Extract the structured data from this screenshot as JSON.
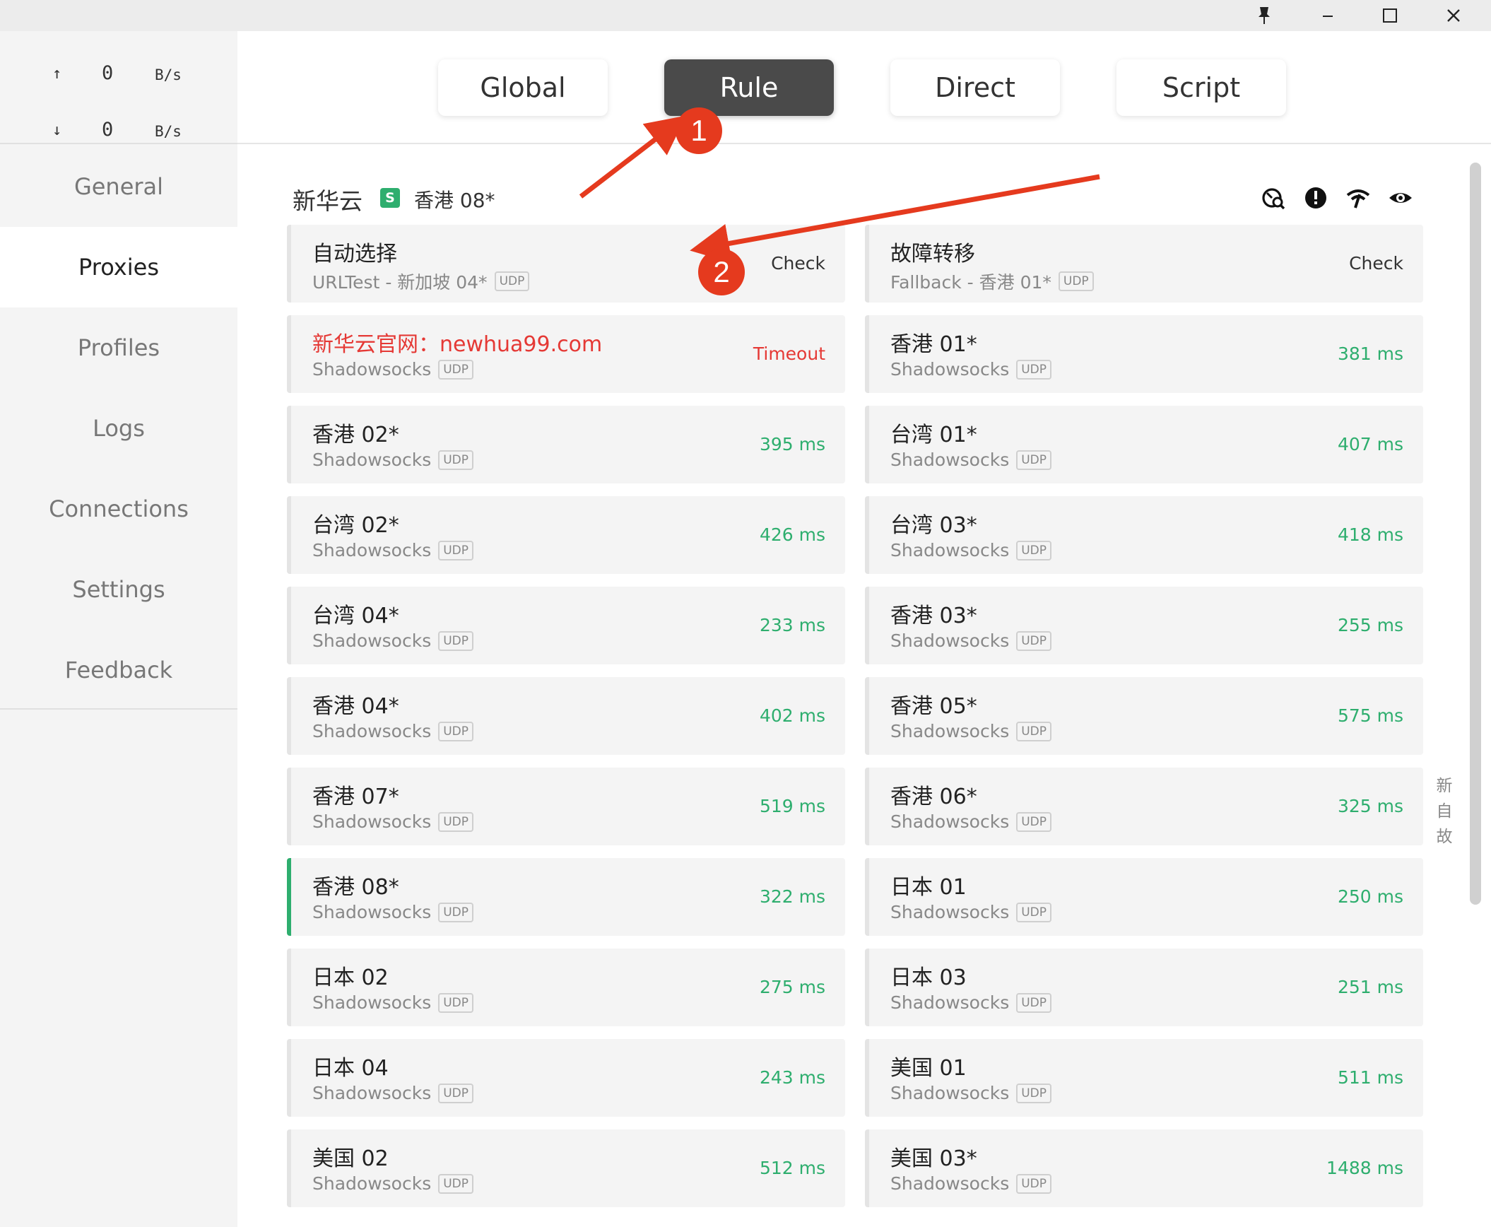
{
  "window_controls": {
    "pin": "pin-icon",
    "minimize": "minimize-icon",
    "maximize": "maximize-icon",
    "close": "close-icon"
  },
  "traffic": {
    "up": {
      "arrow": "↑",
      "value": "0",
      "unit": "B/s"
    },
    "down": {
      "arrow": "↓",
      "value": "0",
      "unit": "B/s"
    }
  },
  "nav": [
    {
      "label": "General",
      "active": false
    },
    {
      "label": "Proxies",
      "active": true
    },
    {
      "label": "Profiles",
      "active": false
    },
    {
      "label": "Logs",
      "active": false
    },
    {
      "label": "Connections",
      "active": false
    },
    {
      "label": "Settings",
      "active": false
    },
    {
      "label": "Feedback",
      "active": false
    }
  ],
  "modes": [
    {
      "label": "Global",
      "active": false
    },
    {
      "label": "Rule",
      "active": true
    },
    {
      "label": "Direct",
      "active": false
    },
    {
      "label": "Script",
      "active": false
    }
  ],
  "group": {
    "name": "新华云",
    "badge": "S",
    "selected": "香港 08*",
    "icons": [
      "speed-test-icon",
      "alert-icon",
      "wifi-icon",
      "eye-icon"
    ]
  },
  "accent_color": "#2eae6e",
  "timeout_color": "#e53935",
  "proxies": [
    {
      "name": "自动选择",
      "type": "URLTest - 新加坡 04*",
      "udp": "UDP",
      "delay": "Check",
      "status": "check"
    },
    {
      "name": "故障转移",
      "type": "Fallback - 香港 01*",
      "udp": "UDP",
      "delay": "Check",
      "status": "check"
    },
    {
      "name": "新华云官网：newhua99.com",
      "type": "Shadowsocks",
      "udp": "UDP",
      "delay": "Timeout",
      "status": "timeout",
      "red": true
    },
    {
      "name": "香港 01*",
      "type": "Shadowsocks",
      "udp": "UDP",
      "delay": "381 ms",
      "status": "ok"
    },
    {
      "name": "香港 02*",
      "type": "Shadowsocks",
      "udp": "UDP",
      "delay": "395 ms",
      "status": "ok"
    },
    {
      "name": "台湾 01*",
      "type": "Shadowsocks",
      "udp": "UDP",
      "delay": "407 ms",
      "status": "ok"
    },
    {
      "name": "台湾 02*",
      "type": "Shadowsocks",
      "udp": "UDP",
      "delay": "426 ms",
      "status": "ok"
    },
    {
      "name": "台湾 03*",
      "type": "Shadowsocks",
      "udp": "UDP",
      "delay": "418 ms",
      "status": "ok"
    },
    {
      "name": "台湾 04*",
      "type": "Shadowsocks",
      "udp": "UDP",
      "delay": "233 ms",
      "status": "ok"
    },
    {
      "name": "香港 03*",
      "type": "Shadowsocks",
      "udp": "UDP",
      "delay": "255 ms",
      "status": "ok"
    },
    {
      "name": "香港 04*",
      "type": "Shadowsocks",
      "udp": "UDP",
      "delay": "402 ms",
      "status": "ok"
    },
    {
      "name": "香港 05*",
      "type": "Shadowsocks",
      "udp": "UDP",
      "delay": "575 ms",
      "status": "ok"
    },
    {
      "name": "香港 07*",
      "type": "Shadowsocks",
      "udp": "UDP",
      "delay": "519 ms",
      "status": "ok"
    },
    {
      "name": "香港 06*",
      "type": "Shadowsocks",
      "udp": "UDP",
      "delay": "325 ms",
      "status": "ok"
    },
    {
      "name": "香港 08*",
      "type": "Shadowsocks",
      "udp": "UDP",
      "delay": "322 ms",
      "status": "ok",
      "selected": true
    },
    {
      "name": "日本 01",
      "type": "Shadowsocks",
      "udp": "UDP",
      "delay": "250 ms",
      "status": "ok"
    },
    {
      "name": "日本 02",
      "type": "Shadowsocks",
      "udp": "UDP",
      "delay": "275 ms",
      "status": "ok"
    },
    {
      "name": "日本 03",
      "type": "Shadowsocks",
      "udp": "UDP",
      "delay": "251 ms",
      "status": "ok"
    },
    {
      "name": "日本 04",
      "type": "Shadowsocks",
      "udp": "UDP",
      "delay": "243 ms",
      "status": "ok"
    },
    {
      "name": "美国 01",
      "type": "Shadowsocks",
      "udp": "UDP",
      "delay": "511 ms",
      "status": "ok"
    },
    {
      "name": "美国 02",
      "type": "Shadowsocks",
      "udp": "UDP",
      "delay": "512 ms",
      "status": "ok"
    },
    {
      "name": "美国 03*",
      "type": "Shadowsocks",
      "udp": "UDP",
      "delay": "1488 ms",
      "status": "ok"
    }
  ],
  "side_letters": [
    "新",
    "自",
    "故"
  ],
  "annotations": {
    "marker1": "1",
    "marker2": "2",
    "color": "#e53a1e"
  }
}
